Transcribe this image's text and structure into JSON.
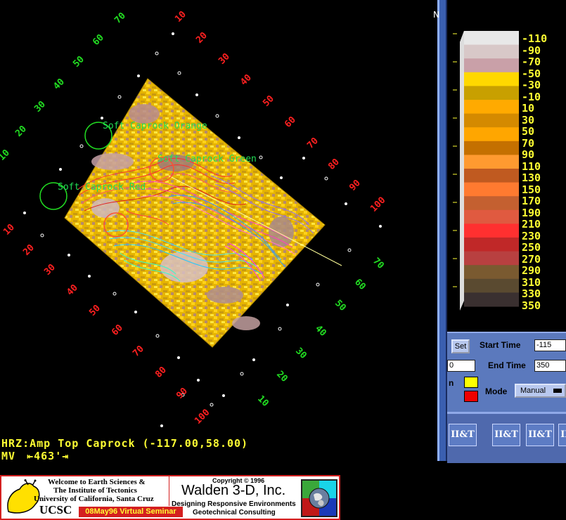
{
  "viewport": {
    "annotations": {
      "soft_orange": "Soft Caprock Orange",
      "soft_green": "Soft Caprock Green",
      "soft_red": "Soft Caprock Red"
    },
    "grid": {
      "left_green": [
        "70",
        "60",
        "50",
        "40",
        "30",
        "20",
        "10"
      ],
      "left_red": [
        "10",
        "20",
        "30",
        "40",
        "50",
        "60",
        "70",
        "80",
        "90",
        "100"
      ],
      "right_red": [
        "10",
        "20",
        "30",
        "40",
        "50",
        "60",
        "70",
        "80",
        "90",
        "100"
      ],
      "right_green": [
        "70",
        "60",
        "50",
        "40",
        "30",
        "20",
        "10"
      ]
    }
  },
  "status": {
    "horizon_line": "HRZ:Amp Top Caprock (-117.00,58.00)",
    "mv_prefix": "MV",
    "mv_value": "463'"
  },
  "colorbar": {
    "labels": [
      "-110",
      "-90",
      "-70",
      "-50",
      "-30",
      "-10",
      "10",
      "30",
      "50",
      "70",
      "90",
      "110",
      "130",
      "150",
      "170",
      "190",
      "210",
      "230",
      "250",
      "270",
      "290",
      "310",
      "330",
      "350"
    ],
    "colors": [
      "#e8e8e8",
      "#d8c8c8",
      "#c9a0a8",
      "#ffd800",
      "#c8a000",
      "#ffaa00",
      "#d48a00",
      "#ffa600",
      "#c47000",
      "#ff9a30",
      "#c05a20",
      "#ff7a30",
      "#c46030",
      "#e05a40",
      "#ff3030",
      "#c02828",
      "#b84040",
      "#7a5a30",
      "#5a4a30",
      "#3a3030"
    ]
  },
  "controls": {
    "set_button": "Set",
    "start_time_label": "Start Time",
    "start_time_value": "-115",
    "end_time_label": "End Time",
    "end_time_value": "350",
    "left_field_value": "0",
    "n_label": "n",
    "mode_label": "Mode",
    "mode_value": "Manual",
    "swatch_top": "#ffff00",
    "swatch_bottom": "#ee0000"
  },
  "logos": [
    "II&T",
    "II&T",
    "II&T",
    "II&T"
  ],
  "banner": {
    "welcome_line1": "Welcome to Earth Sciences &",
    "welcome_line2": "The Institute of Tectonics",
    "welcome_line3": "University of California, Santa Cruz",
    "ucsc": "UCSC",
    "seminar": "08May96 Virtual Seminar",
    "copyright": "Copyright © 1996",
    "company": "Walden 3-D, Inc.",
    "tagline1": "Designing Responsive Environments",
    "tagline2": "Geotechnical Consulting"
  }
}
